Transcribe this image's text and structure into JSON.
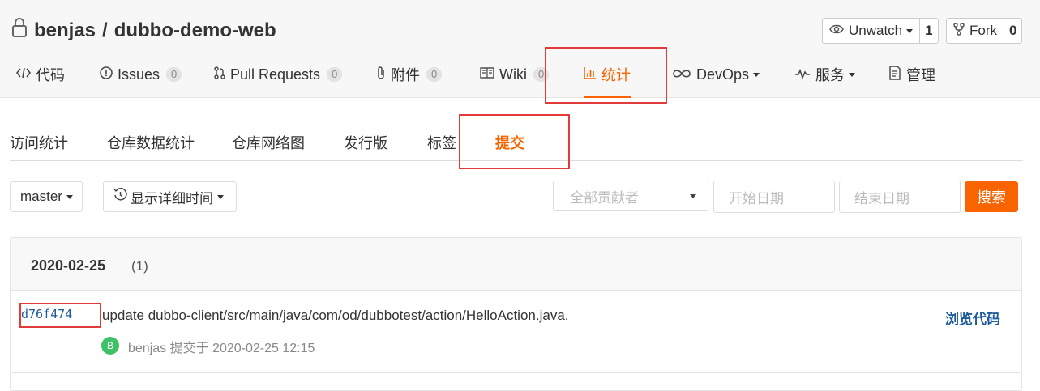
{
  "repo": {
    "owner": "benjas",
    "separator": "/",
    "name": "dubbo-demo-web"
  },
  "watch": {
    "label": "Unwatch",
    "count": "1"
  },
  "fork": {
    "label": "Fork",
    "count": "0"
  },
  "tabs": [
    {
      "label": "代码",
      "icon": "code-icon"
    },
    {
      "label": "Issues",
      "badge": "0",
      "icon": "issue-icon"
    },
    {
      "label": "Pull Requests",
      "badge": "0",
      "icon": "pull-request-icon"
    },
    {
      "label": "附件",
      "badge": "0",
      "icon": "paperclip-icon"
    },
    {
      "label": "Wiki",
      "badge": "0",
      "icon": "book-icon"
    },
    {
      "label": "统计",
      "icon": "bar-chart-icon",
      "active": true
    },
    {
      "label": "DevOps",
      "icon": "infinity-icon"
    },
    {
      "label": "服务",
      "icon": "pulse-icon"
    },
    {
      "label": "管理",
      "icon": "document-icon"
    }
  ],
  "subtabs": [
    "访问统计",
    "仓库数据统计",
    "仓库网络图",
    "发行版",
    "标签",
    "提交"
  ],
  "filters": {
    "branch": "master",
    "time_mode": "显示详细时间",
    "contributors": "全部贡献者",
    "start_date_placeholder": "开始日期",
    "end_date_placeholder": "结束日期",
    "search": "搜索"
  },
  "commit_group": {
    "date": "2020-02-25",
    "count": "(1)",
    "commits": [
      {
        "sha": "d76f474",
        "message": "update dubbo-client/src/main/java/com/od/dubbotest/action/HelloAction.java.",
        "browse": "浏览代码",
        "avatar": "B",
        "author_line": "benjas 提交于 2020-02-25 12:15"
      }
    ]
  },
  "colors": {
    "accent": "#fa6400",
    "highlight_box": "#e23b3b",
    "link": "#1d5c9a",
    "avatar": "#3fc266"
  }
}
